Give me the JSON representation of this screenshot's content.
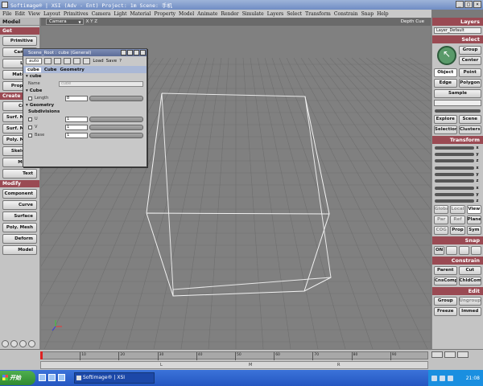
{
  "window": {
    "title": "Softimage® | XSI (Adv - Ent) Project: 1m      Scene: 手机",
    "controls": [
      "_",
      "□",
      "×"
    ]
  },
  "menu": [
    "File",
    "Edit",
    "View",
    "Layout",
    "Primitives",
    "Camera",
    "Light",
    "Material",
    "Property",
    "Model",
    "Animate",
    "Render",
    "Simulate",
    "Layers",
    "Select",
    "Transform",
    "Constrain",
    "Snap",
    "Help"
  ],
  "left_panel": {
    "header": "Model",
    "sections": [
      {
        "name": "Get",
        "buttons": [
          "Primitive",
          "Camera",
          "Light",
          "Material",
          "Property"
        ]
      },
      {
        "name": "Create",
        "buttons": [
          "Curve",
          "Surf. Mesh",
          "Surf. Mesh",
          "Poly. Mesh",
          "Skeleton",
          "Model",
          "Text"
        ]
      },
      {
        "name": "Modify",
        "buttons": [
          "Component",
          "Curve",
          "Surface",
          "Poly. Mesh",
          "Deform",
          "Model"
        ]
      }
    ]
  },
  "viewport": {
    "camera": "Camera",
    "axes_label": "X Y Z",
    "depth_label": "Depth Cue"
  },
  "property_editor": {
    "title": "Scene_Root : cube (General)",
    "auto": "auto",
    "load": "Load",
    "save": "Save",
    "help": "?",
    "tabs": [
      "cube",
      "Cube",
      "Geometry"
    ],
    "cube_section": "cube",
    "name_label": "Name",
    "name_value": "cube",
    "cube_sub": "Cube",
    "length_label": "Length",
    "length_value": "8",
    "geometry_section": "Geometry",
    "subdivisions": "Subdivisions",
    "u_label": "U",
    "u_value": "1",
    "v_label": "V",
    "v_value": "1",
    "base_label": "Base",
    "base_value": "1"
  },
  "right_panel": {
    "layers_title": "Layers",
    "layer_field": "Layer_Default",
    "select_title": "Select",
    "group": "Group",
    "center": "Center",
    "object": "Object",
    "point": "Point",
    "edge": "Edge",
    "polygon": "Polygon",
    "sample": "Sample",
    "explore": "Explore",
    "scene": "Scene",
    "selection": "Selection",
    "clusters": "Clusters",
    "transform_title": "Transform",
    "axes": [
      "x",
      "y",
      "z"
    ],
    "global": "Global",
    "local": "Local",
    "view": "View",
    "par": "Par",
    "ref": "Ref",
    "plane": "Plane",
    "cog": "COG",
    "prop": "Prop",
    "sym": "Sym",
    "snap_title": "Snap",
    "snap_on": "ON",
    "constrain_title": "Constrain",
    "parent": "Parent",
    "cut": "Cut",
    "cnscomp": "CnsComp",
    "chldcomp": "ChldComp",
    "edit_title": "Edit",
    "edit_group": "Group",
    "ungroup": "Ungroup",
    "freeze": "Freeze",
    "immed": "Immed"
  },
  "timeline": {
    "ticks": [
      "10",
      "20",
      "30",
      "40",
      "50",
      "60",
      "70",
      "80",
      "90"
    ],
    "markers": [
      "L",
      "M",
      "R"
    ],
    "current_frame": "1"
  },
  "taskbar": {
    "start": "开始",
    "app_task": "Softimage® | XSI",
    "clock": "21:08"
  }
}
